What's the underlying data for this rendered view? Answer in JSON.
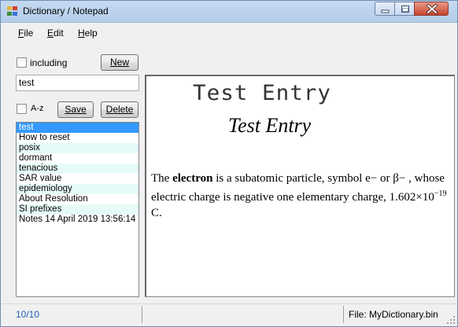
{
  "window": {
    "title": "Dictionary / Notepad",
    "icon": "app-dictionary-icon"
  },
  "menu": {
    "items": [
      {
        "label": "File"
      },
      {
        "label": "Edit"
      },
      {
        "label": "Help"
      }
    ]
  },
  "left_panel": {
    "including_label": "including",
    "including_checked": false,
    "new_button": "New",
    "search_value": "test",
    "az_label": "A-z",
    "az_checked": false,
    "save_button": "Save",
    "delete_button": "Delete",
    "entries": [
      {
        "text": "test",
        "selected": true
      },
      {
        "text": "How to reset"
      },
      {
        "text": "posix"
      },
      {
        "text": "dormant"
      },
      {
        "text": "tenacious"
      },
      {
        "text": "SAR value"
      },
      {
        "text": "epidemiology"
      },
      {
        "text": "About Resolution"
      },
      {
        "text": "SI prefixes"
      },
      {
        "text": "Notes  14 April 2019 13:56:14"
      }
    ]
  },
  "viewer": {
    "heading_mono": "Test Entry",
    "heading_serif": "Test Entry",
    "body_prefix": "The ",
    "body_bold": "electron",
    "body_mid": " is a subatomic particle, symbol e−  or  β− , whose electric charge is negative one elementary charge, 1.602×10",
    "body_sup": "−19",
    "body_suffix": " C."
  },
  "status": {
    "count": "10/10",
    "file": "File: MyDictionary.bin"
  }
}
